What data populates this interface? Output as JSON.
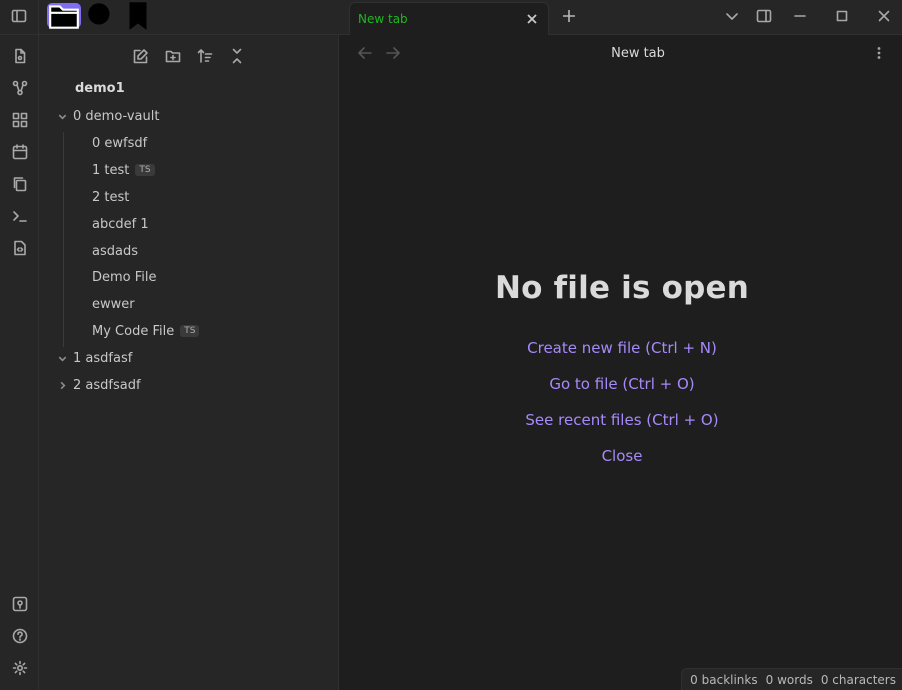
{
  "ribbon": {
    "top_icons": [
      "file-icon",
      "graph-icon",
      "layout-icon",
      "calendar-icon",
      "copy-icon",
      "terminal-icon",
      "code-file-icon"
    ],
    "bottom_icons": [
      "vault-icon",
      "help-icon",
      "settings-icon"
    ]
  },
  "sidebar_tabs": [
    "sidebar-toggle-icon",
    "folder-icon",
    "search-icon",
    "bookmark-icon"
  ],
  "file_tools": [
    "new-note-icon",
    "new-folder-icon",
    "sort-icon",
    "collapse-icon"
  ],
  "explorer": {
    "vault_name": "demo1",
    "items": [
      {
        "label": "0 demo-vault",
        "type": "folder",
        "expanded": true
      },
      {
        "label": "0 ewfsdf",
        "type": "file"
      },
      {
        "label": "1 test",
        "type": "file",
        "badge": "TS"
      },
      {
        "label": "2 test",
        "type": "file"
      },
      {
        "label": "abcdef 1",
        "type": "file"
      },
      {
        "label": "asdads",
        "type": "file"
      },
      {
        "label": "Demo File",
        "type": "file"
      },
      {
        "label": "ewwer",
        "type": "file"
      },
      {
        "label": "My Code File",
        "type": "file",
        "badge": "TS"
      },
      {
        "label": "1 asdfasf",
        "type": "folder",
        "expanded": true
      },
      {
        "label": "2 asdfsadf",
        "type": "folder",
        "expanded": false
      }
    ]
  },
  "tabs": [
    {
      "label": "New tab",
      "active": true
    }
  ],
  "view": {
    "title": "New tab"
  },
  "empty_state": {
    "heading": "No file is open",
    "actions": [
      "Create new file (Ctrl + N)",
      "Go to file (Ctrl + O)",
      "See recent files (Ctrl + O)",
      "Close"
    ]
  },
  "status": {
    "backlinks": "0 backlinks",
    "words": "0 words",
    "characters": "0 characters"
  },
  "colors": {
    "accent": "#7f6df2",
    "link": "#a68af9",
    "tab_text": "#21b521"
  }
}
